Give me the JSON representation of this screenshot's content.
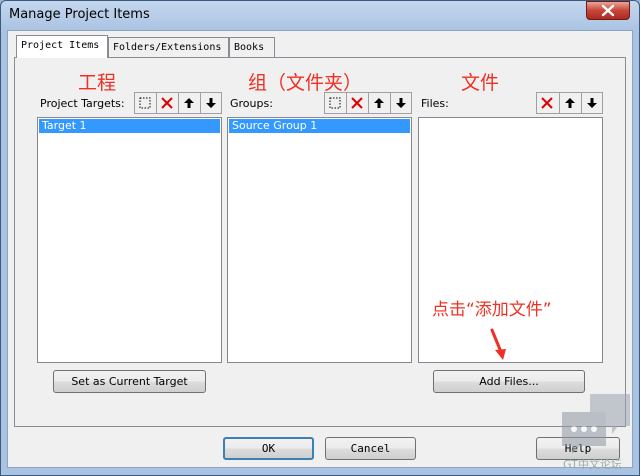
{
  "window": {
    "title": "Manage Project Items"
  },
  "tabs": [
    {
      "label": "Project Items",
      "active": true
    },
    {
      "label": "Folders/Extensions",
      "active": false
    },
    {
      "label": "Books",
      "active": false
    }
  ],
  "annotations": {
    "project_cn": "工程",
    "groups_cn": "组（文件夹）",
    "files_cn": "文件",
    "add_files_hint": "点击“添加文件”"
  },
  "panels": {
    "targets": {
      "label": "Project Targets:",
      "items": [
        "Target 1"
      ],
      "selected": "Target 1"
    },
    "groups": {
      "label": "Groups:",
      "items": [
        "Source Group 1"
      ],
      "selected": "Source Group 1"
    },
    "files": {
      "label": "Files:",
      "items": []
    }
  },
  "buttons": {
    "set_current": "Set as Current Target",
    "add_files": "Add Files...",
    "ok": "OK",
    "cancel": "Cancel",
    "help": "Help"
  },
  "colors": {
    "annotation": "#ee3124",
    "selection": "#3399ff"
  },
  "icons": [
    "new-icon",
    "delete-icon",
    "move-up-icon",
    "move-down-icon",
    "close-icon"
  ],
  "watermark": "GT中文论坛"
}
